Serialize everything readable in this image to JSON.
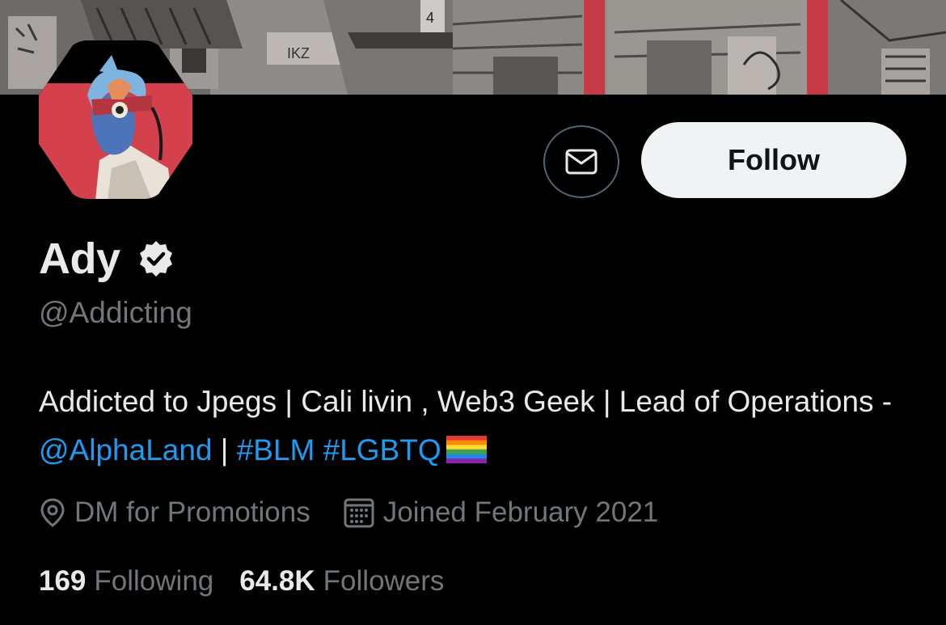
{
  "profile": {
    "name": "Ady",
    "handle": "@Addicting",
    "verified_icon": "verified-badge-icon",
    "bio": {
      "text1": "Addicted to Jpegs | Cali livin , Web3 Geek | Lead of Operations - ",
      "mention": "@AlphaLand",
      "sep": " | ",
      "hashtag1": "#BLM",
      "space": " ",
      "hashtag2": "#LGBTQ",
      "flag_icon": "rainbow-flag-emoji"
    },
    "location": "DM for Promotions",
    "joined": "Joined February 2021",
    "following_count": "169",
    "following_label": "Following",
    "followers_count": "64.8K",
    "followers_label": "Followers"
  },
  "actions": {
    "follow_label": "Follow",
    "message_icon": "envelope-icon"
  },
  "icons": {
    "location": "location-pin-icon",
    "calendar": "calendar-icon"
  },
  "colors": {
    "background": "#000000",
    "text_primary": "#e7e9ea",
    "text_secondary": "#71767b",
    "link": "#1d9bf0",
    "follow_bg": "#eff3f4",
    "avatar_bg": "#d4404c"
  }
}
